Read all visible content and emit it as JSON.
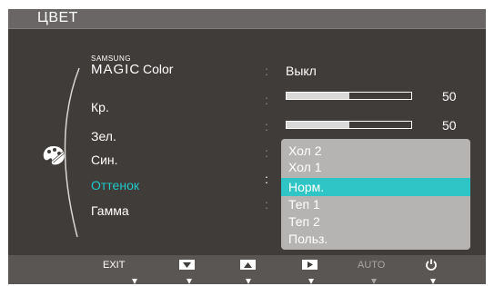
{
  "window": {
    "title": "ЦВЕТ"
  },
  "colors": {
    "accent": "#1ec9c8",
    "selected_bg": "#2fc5c6",
    "panel_bg": "#403c3a"
  },
  "icons": {
    "menu_icon": "palette-icon",
    "power_icon": "power-icon"
  },
  "menu": {
    "magic_brand": "SAMSUNG",
    "magic_word": "MAGIC",
    "magic_color": "Color",
    "items": [
      {
        "label": "Кр."
      },
      {
        "label": "Зел."
      },
      {
        "label": "Син."
      },
      {
        "label": "Оттенок"
      },
      {
        "label": "Гамма"
      }
    ]
  },
  "values": {
    "magic_color": "Выкл",
    "red": {
      "value": "50",
      "fraction": 0.5
    },
    "green": {
      "value": "50",
      "fraction": 0.5
    }
  },
  "colon": ":",
  "dropdown": {
    "options": [
      "Хол 2",
      "Хол 1",
      "Норм.",
      "Теп 1",
      "Теп 2",
      "Польз."
    ],
    "selected": "Норм."
  },
  "bottombar": {
    "exit": "EXIT",
    "auto": "AUTO",
    "down_icon": "down-arrow-icon",
    "up_icon": "up-arrow-icon",
    "enter_icon": "enter-arrow-icon"
  }
}
